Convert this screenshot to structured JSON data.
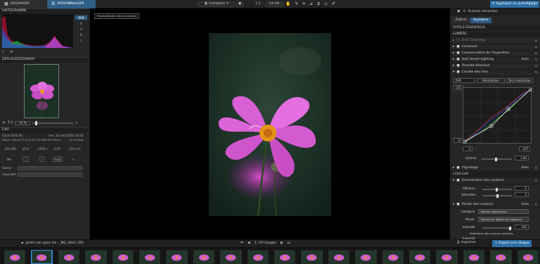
{
  "tabs": {
    "organize": "ORGANISER",
    "customize": "PERSONNALISER"
  },
  "toolbar": {
    "compare": "Comparer",
    "ratio": "1:1",
    "zoom": "14 %"
  },
  "apply_auto": "Appliquer un autoréglage",
  "left": {
    "histogram": "HISTOGRAMME",
    "channels": [
      "RVB",
      "R",
      "V",
      "B",
      "L"
    ],
    "navigator": "DÉPLACER/ZOOMER",
    "nav_ratio": "1:1",
    "nav_zoom": "14 %",
    "exif": "EXIF",
    "camera": "Canon EOS 80",
    "date": "ven. 10 août 2018 14:54",
    "lens": "Sigma 150mm F2.8 EX DG OS HSM APO Macro",
    "dims": "5472x3648",
    "iso": "ISO 400",
    "aperture": "f/5.0",
    "shutter": "1/500 s",
    "ev": "0 EV",
    "focal": "150 mm",
    "mode": "M",
    "auto_label": "Auto",
    "author": "Auteur",
    "copyright": "Copyright"
  },
  "viewer": {
    "preview_badge": "Prévisualisation des corrections"
  },
  "right": {
    "no_correction": "4 - Aucune correction",
    "edition_tab": "Édition",
    "apply_tab": "Appliquer",
    "essentials": "OUTILS ESSENTIELS",
    "light": "LUMIÈRE",
    "items": [
      "DxO ClearView",
      "Contraste",
      "Compensation de l'exposition",
      "DxO Smart Lighting",
      "Tonalité sélective",
      "Courbe des tons"
    ],
    "smart_auto": "Auto",
    "curve_channel": "RVB",
    "reinit": "Réinitialiser",
    "reinit_all": "Tout réinitialiser",
    "curve_top": "255",
    "curve_bottom": "13",
    "curve_x0": "0",
    "curve_x255": "255",
    "gamma_label": "Gamma",
    "gamma_value": "1,00",
    "vignetting": "Vignetage",
    "vign_auto": "Auto",
    "color": "COULEUR",
    "color_accent": "Accentuation des couleurs",
    "vibrance": "Vibrance",
    "vibrance_value": "-2",
    "saturation": "Saturation",
    "saturation_value": "0",
    "color_render": "Rendu des couleurs",
    "render_auto": "Auto",
    "category": "Catégorie",
    "category_value": "Rendus génériques",
    "render": "Rendu",
    "render_value": "Rendu par défaut de l'appareil",
    "intensity": "Intensité",
    "intensity_value": "100",
    "protection": "Protection des couleurs saturées",
    "intensity2": "Intensité"
  },
  "status": {
    "path": "Jardin soir gaux lot - _MG_5641.CR2",
    "pager": "1 / 97 images",
    "print": "Imprimer",
    "export": "Export vers disque"
  },
  "filmstrip_count": 20
}
